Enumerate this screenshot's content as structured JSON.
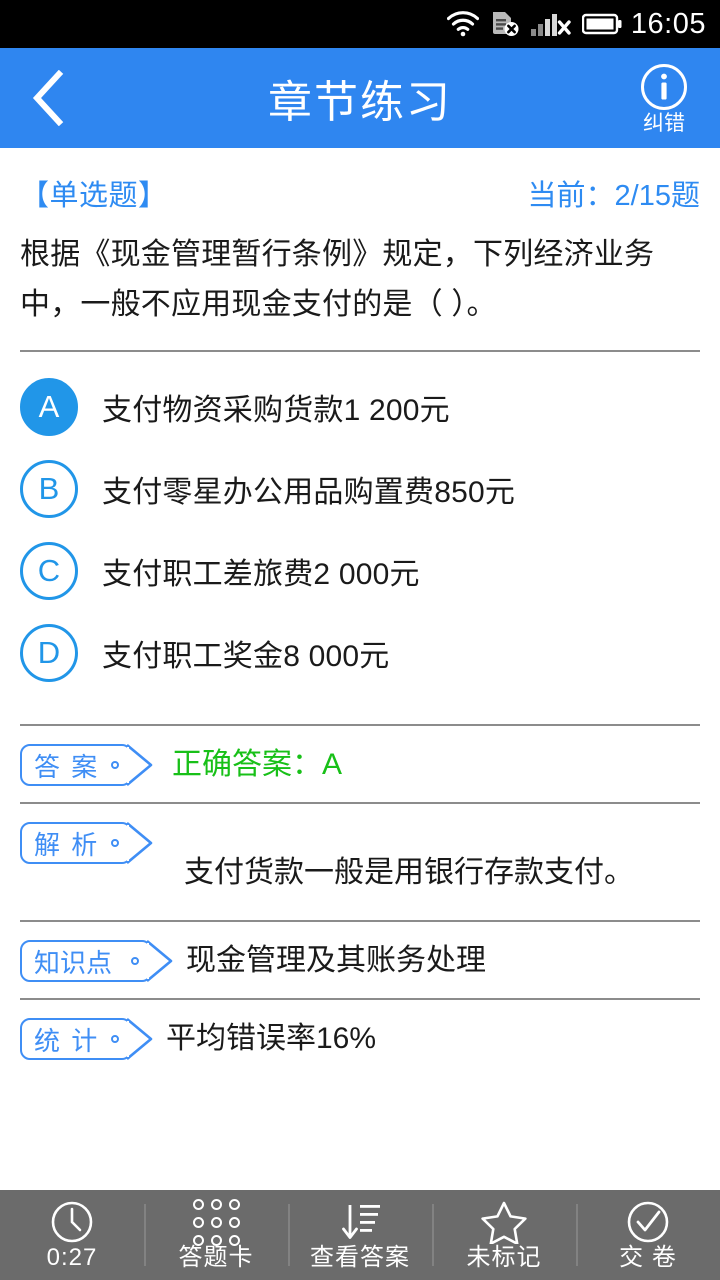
{
  "status_bar": {
    "time": "16:05",
    "icons": [
      "wifi-icon",
      "sim-card-error-icon",
      "signal-no-service-icon",
      "battery-icon"
    ]
  },
  "header": {
    "title": "章节练习",
    "back_icon": "chevron-left-icon",
    "report_error": {
      "icon": "info-circle-icon",
      "label": "纠错"
    },
    "background_color": "#2f86f0"
  },
  "question": {
    "type_label": "【单选题】",
    "progress_label": "当前：2/15题",
    "stem": "根据《现金管理暂行条例》规定，下列经济业务中，一般不应用现金支付的是（    ）。",
    "accent_color": "#2e8bf2",
    "options": [
      {
        "letter": "A",
        "text": "支付物资采购货款1 200元",
        "selected": true
      },
      {
        "letter": "B",
        "text": "支付零星办公用品购置费850元",
        "selected": false
      },
      {
        "letter": "C",
        "text": "支付职工差旅费2 000元",
        "selected": false
      },
      {
        "letter": "D",
        "text": "支付职工奖金8 000元",
        "selected": false
      }
    ]
  },
  "info_rows": {
    "answer": {
      "tag": "答 案",
      "value": "正确答案：A",
      "value_color": "#18c018"
    },
    "analysis": {
      "tag": "解 析",
      "value": "支付货款一般是用银行存款支付。"
    },
    "knowledge": {
      "tag": "知识点",
      "value": "现金管理及其账务处理"
    },
    "stats": {
      "tag": "统 计",
      "value": "平均错误率16%"
    }
  },
  "toolbar": {
    "background_color": "#6b6b6b",
    "items": [
      {
        "icon": "clock-icon",
        "label": "0:27"
      },
      {
        "icon": "answer-sheet-grid-icon",
        "label": "答题卡"
      },
      {
        "icon": "view-answer-sort-icon",
        "label": "查看答案"
      },
      {
        "icon": "star-outline-icon",
        "label": "未标记"
      },
      {
        "icon": "check-circle-icon",
        "label": "交 卷"
      }
    ]
  }
}
